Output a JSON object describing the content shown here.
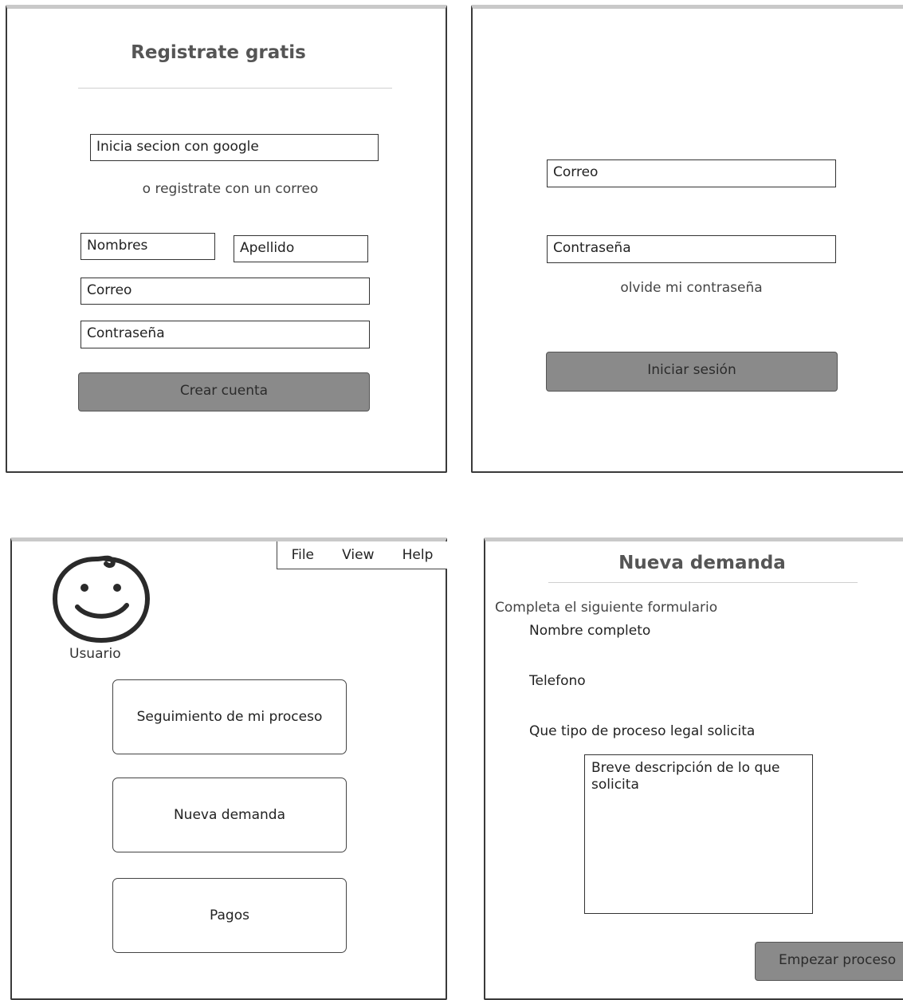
{
  "register": {
    "title": "Registrate gratis",
    "google_button": "Inicia secion con google",
    "or_text": "o registrate con un correo",
    "first_name": "Nombres",
    "last_name": "Apellido",
    "email": "Correo",
    "password": "Contraseña",
    "submit": "Crear cuenta"
  },
  "login": {
    "email": "Correo",
    "password": "Contraseña",
    "forgot": "olvide mi contraseña",
    "submit": "Iniciar sesión"
  },
  "dashboard": {
    "menu": [
      "File",
      "View",
      "Help"
    ],
    "avatar_icon": "smiley-face-icon",
    "user_label": "Usuario",
    "cards": [
      "Seguimiento de mi proceso",
      "Nueva demanda",
      "Pagos"
    ]
  },
  "new_claim": {
    "title": "Nueva demanda",
    "subtitle": "Completa el siguiente formulario",
    "full_name_label": "Nombre completo",
    "phone_label": "Telefono",
    "process_type_label": "Que tipo de proceso legal solicita",
    "description_placeholder": "Breve descripción de lo que solicita",
    "submit": "Empezar proceso"
  }
}
